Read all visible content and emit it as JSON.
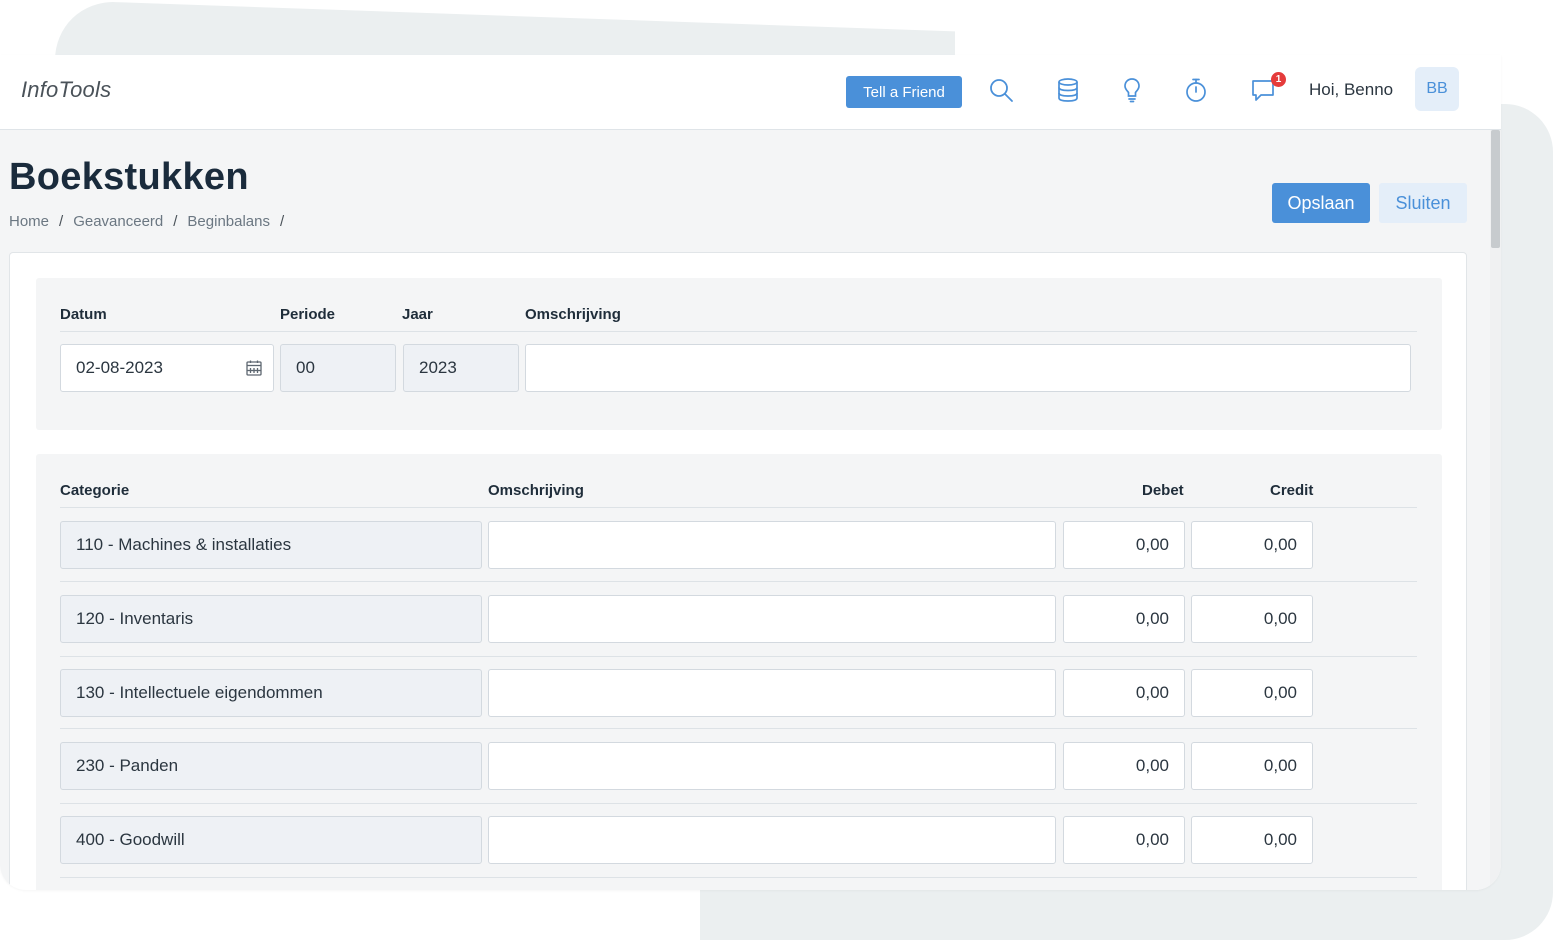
{
  "app": {
    "brand": "InfoTools"
  },
  "navbar": {
    "tell_a_friend": "Tell a Friend",
    "notification_count": "1",
    "greeting": "Hoi, Benno",
    "avatar_initials": "BB",
    "icons": [
      "search-icon",
      "database-icon",
      "lightbulb-icon",
      "stopwatch-icon",
      "chat-icon"
    ]
  },
  "page": {
    "title": "Boekstukken",
    "breadcrumb": [
      "Home",
      "Geavanceerd",
      "Beginbalans"
    ],
    "save_label": "Opslaan",
    "close_label": "Sluiten"
  },
  "header_form": {
    "labels": {
      "datum": "Datum",
      "periode": "Periode",
      "jaar": "Jaar",
      "omschrijving": "Omschrijving"
    },
    "datum": "02-08-2023",
    "periode": "00",
    "jaar": "2023",
    "omschrijving": ""
  },
  "lines": {
    "columns": {
      "categorie": "Categorie",
      "omschrijving": "Omschrijving",
      "debet": "Debet",
      "credit": "Credit"
    },
    "rows": [
      {
        "categorie": "110 - Machines & installaties",
        "omschrijving": "",
        "debet": "0,00",
        "credit": "0,00"
      },
      {
        "categorie": "120 - Inventaris",
        "omschrijving": "",
        "debet": "0,00",
        "credit": "0,00"
      },
      {
        "categorie": "130 - Intellectuele eigendommen",
        "omschrijving": "",
        "debet": "0,00",
        "credit": "0,00"
      },
      {
        "categorie": "230 - Panden",
        "omschrijving": "",
        "debet": "0,00",
        "credit": "0,00"
      },
      {
        "categorie": "400 - Goodwill",
        "omschrijving": "",
        "debet": "0,00",
        "credit": "0,00"
      }
    ]
  },
  "colors": {
    "primary": "#4a90d9",
    "primary_light": "#e4eef9",
    "badge": "#e53b3b",
    "title": "#1a2b3c"
  }
}
